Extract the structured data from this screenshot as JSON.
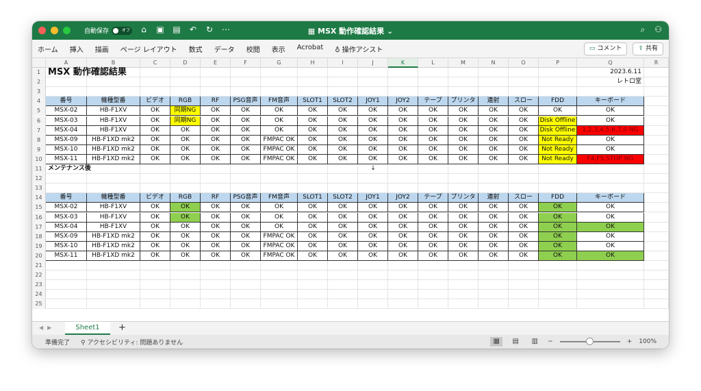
{
  "titlebar": {
    "autosave_label": "自動保存",
    "autosave_state": "オフ",
    "doc_title": "MSX 動作確認結果",
    "title_chevron": "⌄",
    "icons": [
      "home-icon",
      "save-icon",
      "save-as-icon",
      "undo-icon",
      "redo-icon",
      "more-icon"
    ]
  },
  "ribbon": {
    "menu": [
      "ホーム",
      "挿入",
      "描画",
      "ページ レイアウト",
      "数式",
      "データ",
      "校閲",
      "表示",
      "Acrobat",
      "操作アシスト"
    ],
    "comment_label": "コメント",
    "share_label": "共有"
  },
  "columns": [
    "A",
    "B",
    "C",
    "D",
    "E",
    "F",
    "G",
    "H",
    "I",
    "J",
    "K",
    "L",
    "M",
    "N",
    "O",
    "P",
    "Q",
    "R"
  ],
  "selected_column": "K",
  "rows": [
    "1",
    "2",
    "3",
    "4",
    "5",
    "6",
    "7",
    "8",
    "9",
    "10",
    "11",
    "12",
    "13",
    "14",
    "15",
    "16",
    "17",
    "18",
    "19",
    "20",
    "21",
    "22",
    "23",
    "24",
    "25"
  ],
  "sheet": {
    "title": "MSX 動作確認結果",
    "date": "2023.6.11",
    "author": "レトロ堂",
    "arrow": "↓",
    "section2_label": "メンテナンス後",
    "headers": [
      "番号",
      "機種型番",
      "ビデオ",
      "RGB",
      "RF",
      "PSG音声",
      "FM音声",
      "SLOT1",
      "SLOT2",
      "JOY1",
      "JOY2",
      "テープ",
      "プリンタ",
      "連射",
      "スロー",
      "FDD",
      "キーボード"
    ],
    "table1": [
      [
        "MSX-02",
        "HB-F1XV",
        "OK",
        "同期NG",
        "OK",
        "OK",
        "OK",
        "OK",
        "OK",
        "OK",
        "OK",
        "OK",
        "OK",
        "OK",
        "OK",
        "OK",
        "OK"
      ],
      [
        "MSX-03",
        "HB-F1XV",
        "OK",
        "同期NG",
        "OK",
        "OK",
        "OK",
        "OK",
        "OK",
        "OK",
        "OK",
        "OK",
        "OK",
        "OK",
        "OK",
        "Disk Offline",
        "OK"
      ],
      [
        "MSX-04",
        "HB-F1XV",
        "OK",
        "OK",
        "OK",
        "OK",
        "OK",
        "OK",
        "OK",
        "OK",
        "OK",
        "OK",
        "OK",
        "OK",
        "OK",
        "Disk Offline",
        "1,2,3,4,5,6,7,0 NG"
      ],
      [
        "MSX-09",
        "HB-F1XD mk2",
        "OK",
        "OK",
        "OK",
        "OK",
        "FMPAC OK",
        "OK",
        "OK",
        "OK",
        "OK",
        "OK",
        "OK",
        "OK",
        "OK",
        "Not Ready",
        "OK"
      ],
      [
        "MSX-10",
        "HB-F1XD mk2",
        "OK",
        "OK",
        "OK",
        "OK",
        "FMPAC OK",
        "OK",
        "OK",
        "OK",
        "OK",
        "OK",
        "OK",
        "OK",
        "OK",
        "Not Ready",
        "OK"
      ],
      [
        "MSX-11",
        "HB-F1XD mk2",
        "OK",
        "OK",
        "OK",
        "OK",
        "FMPAC OK",
        "OK",
        "OK",
        "OK",
        "OK",
        "OK",
        "OK",
        "OK",
        "OK",
        "Not Ready",
        "F4,F5,STOP NG"
      ]
    ],
    "table1_colors": [
      {
        "row": 0,
        "col": 3,
        "color": "#ffff00"
      },
      {
        "row": 1,
        "col": 3,
        "color": "#ffff00"
      },
      {
        "row": 1,
        "col": 15,
        "color": "#ffff00"
      },
      {
        "row": 2,
        "col": 15,
        "color": "#ffff00"
      },
      {
        "row": 2,
        "col": 16,
        "color": "#ff0000"
      },
      {
        "row": 3,
        "col": 15,
        "color": "#ffff00"
      },
      {
        "row": 4,
        "col": 15,
        "color": "#ffff00"
      },
      {
        "row": 5,
        "col": 15,
        "color": "#ffff00"
      },
      {
        "row": 5,
        "col": 16,
        "color": "#ff0000"
      }
    ],
    "table2": [
      [
        "MSX-02",
        "HB-F1XV",
        "OK",
        "OK",
        "OK",
        "OK",
        "OK",
        "OK",
        "OK",
        "OK",
        "OK",
        "OK",
        "OK",
        "OK",
        "OK",
        "OK",
        "OK"
      ],
      [
        "MSX-03",
        "HB-F1XV",
        "OK",
        "OK",
        "OK",
        "OK",
        "OK",
        "OK",
        "OK",
        "OK",
        "OK",
        "OK",
        "OK",
        "OK",
        "OK",
        "OK",
        "OK"
      ],
      [
        "MSX-04",
        "HB-F1XV",
        "OK",
        "OK",
        "OK",
        "OK",
        "OK",
        "OK",
        "OK",
        "OK",
        "OK",
        "OK",
        "OK",
        "OK",
        "OK",
        "OK",
        "OK"
      ],
      [
        "MSX-09",
        "HB-F1XD mk2",
        "OK",
        "OK",
        "OK",
        "OK",
        "FMPAC OK",
        "OK",
        "OK",
        "OK",
        "OK",
        "OK",
        "OK",
        "OK",
        "OK",
        "OK",
        "OK"
      ],
      [
        "MSX-10",
        "HB-F1XD mk2",
        "OK",
        "OK",
        "OK",
        "OK",
        "FMPAC OK",
        "OK",
        "OK",
        "OK",
        "OK",
        "OK",
        "OK",
        "OK",
        "OK",
        "OK",
        "OK"
      ],
      [
        "MSX-11",
        "HB-F1XD mk2",
        "OK",
        "OK",
        "OK",
        "OK",
        "FMPAC OK",
        "OK",
        "OK",
        "OK",
        "OK",
        "OK",
        "OK",
        "OK",
        "OK",
        "OK",
        "OK"
      ]
    ],
    "table2_colors": [
      {
        "row": 0,
        "col": 3,
        "color": "#8fcf4f"
      },
      {
        "row": 1,
        "col": 3,
        "color": "#8fcf4f"
      },
      {
        "row": 0,
        "col": 15,
        "color": "#8fcf4f"
      },
      {
        "row": 1,
        "col": 15,
        "color": "#8fcf4f"
      },
      {
        "row": 2,
        "col": 15,
        "color": "#8fcf4f"
      },
      {
        "row": 3,
        "col": 15,
        "color": "#8fcf4f"
      },
      {
        "row": 4,
        "col": 15,
        "color": "#8fcf4f"
      },
      {
        "row": 5,
        "col": 15,
        "color": "#8fcf4f"
      },
      {
        "row": 2,
        "col": 16,
        "color": "#8fcf4f"
      },
      {
        "row": 5,
        "col": 16,
        "color": "#8fcf4f"
      }
    ],
    "header_color": "#bdd7ee"
  },
  "tabs": {
    "sheet_name": "Sheet1",
    "add": "+"
  },
  "status": {
    "ready": "準備完了",
    "accessibility": "アクセシビリティ: 問題ありません",
    "zoom_minus": "−",
    "zoom_plus": "+",
    "zoom": "100%",
    "zoom_fraction": 0.5
  }
}
